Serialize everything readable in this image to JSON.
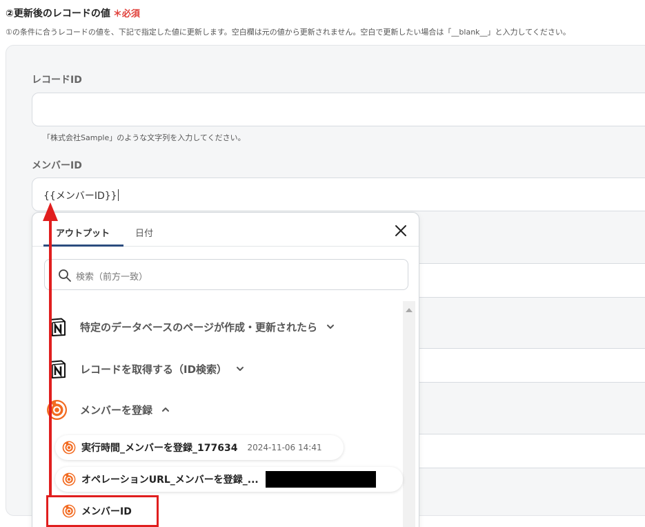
{
  "section": {
    "title": "②更新後のレコードの値",
    "required_mark": "＊",
    "required_label": "必須",
    "description": "①の条件に合うレコードの値を、下記で指定した値に更新します。空白欄は元の値から更新されません。空白で更新したい場合は「__blank__」と入力してください。"
  },
  "fields": {
    "record_id": {
      "label": "レコードID",
      "value": "",
      "hint": "「株式会社Sample」のような文字列を入力してください。"
    },
    "member_id": {
      "label": "メンバーID",
      "value": "{{メンバーID}}"
    }
  },
  "popup": {
    "tabs": [
      "アウトプット",
      "日付"
    ],
    "active_tab": "アウトプット",
    "search_placeholder": "検索（前方一致）",
    "groups": [
      {
        "icon": "notion-icon",
        "label": "特定のデータベースのページが作成・更新されたら",
        "expanded": false
      },
      {
        "icon": "notion-icon",
        "label": "レコードを取得する（ID検索）",
        "expanded": false
      },
      {
        "icon": "yoom-icon",
        "label": "メンバーを登録",
        "expanded": true
      }
    ],
    "items": [
      {
        "icon": "yoom-icon",
        "label": "実行時間_メンバーを登録_177634",
        "meta": "2024-11-06 14:41"
      },
      {
        "icon": "yoom-icon",
        "label": "オペレーションURL_メンバーを登録_...",
        "meta": ""
      },
      {
        "icon": "yoom-icon",
        "label": "メンバーID",
        "meta": ""
      }
    ]
  },
  "colors": {
    "required": "#e0413b",
    "accent_underline": "#2b4c7e",
    "annotation_red": "#e01e1e",
    "yoom_orange": "#f26b21"
  }
}
